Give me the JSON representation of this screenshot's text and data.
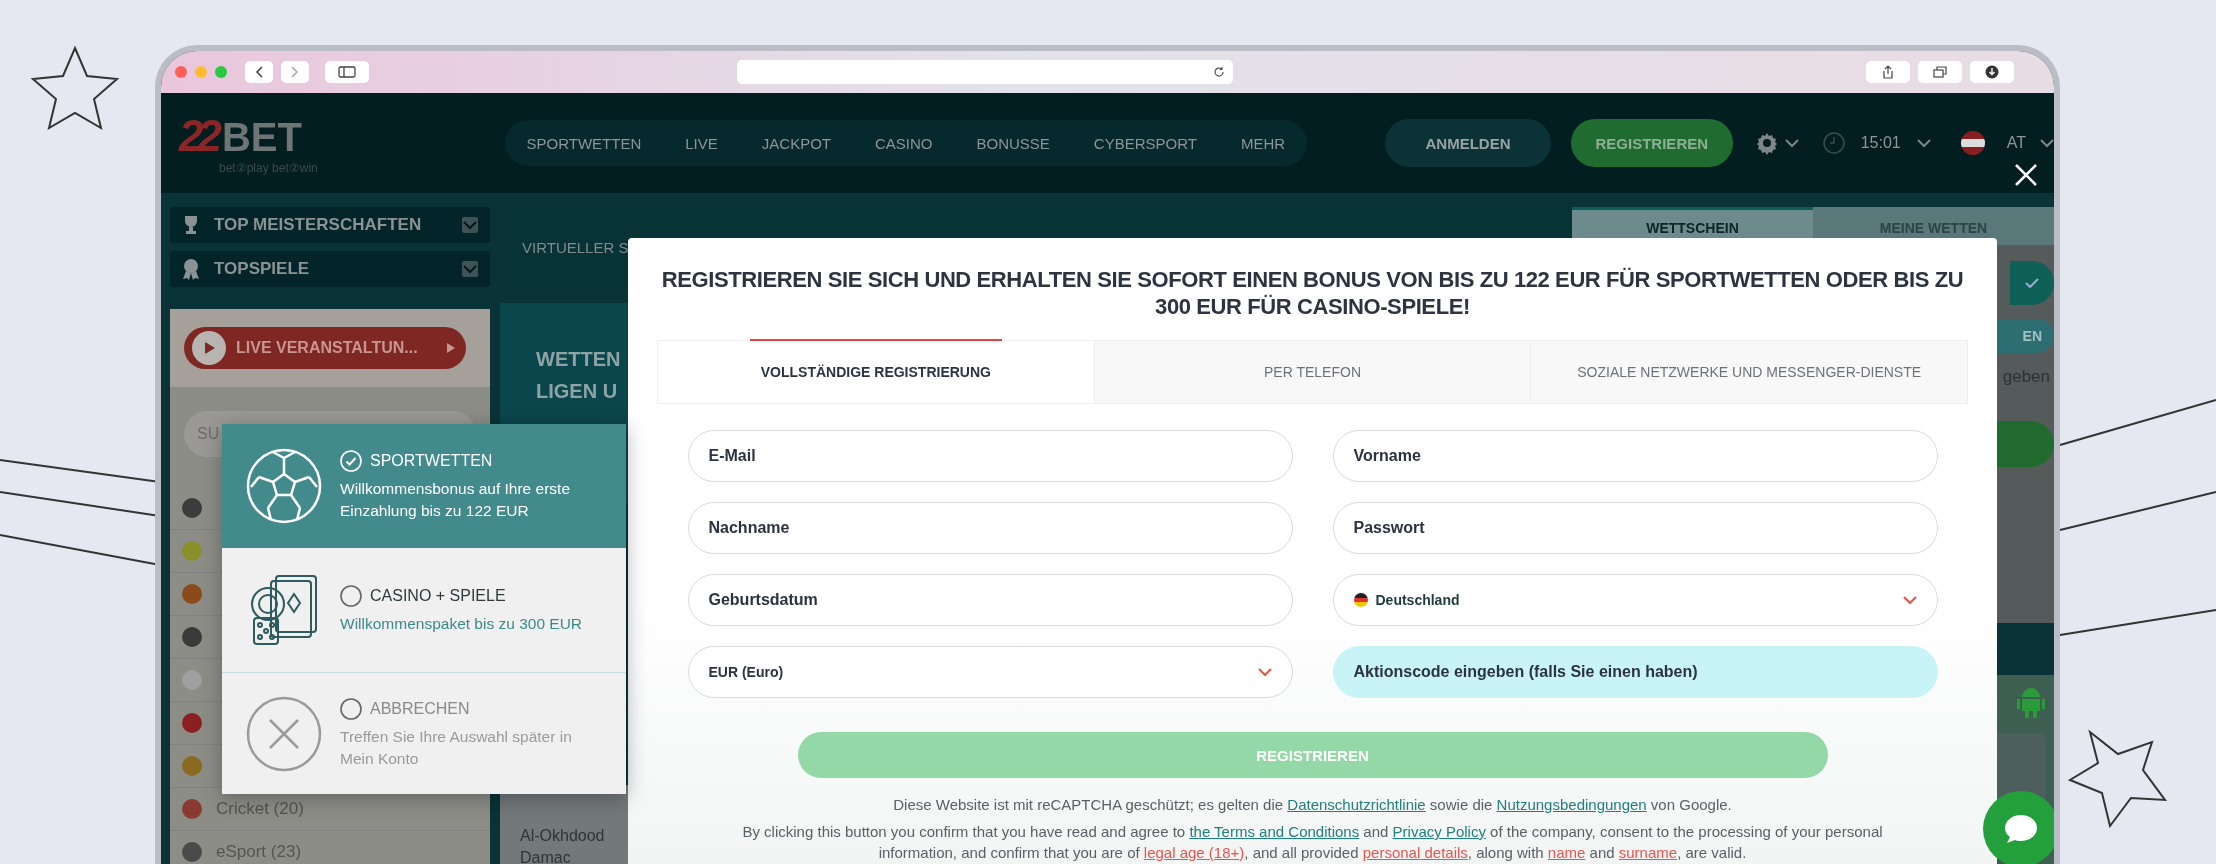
{
  "header": {
    "logo": {
      "brand": "BET",
      "digits": "22",
      "slogan": "bet②play bet②win"
    },
    "nav": [
      "SPORTWETTEN",
      "LIVE",
      "JACKPOT",
      "CASINO",
      "BONUSSE",
      "CYBERSPORT",
      "MEHR"
    ],
    "login_button": "ANMELDEN",
    "register_button": "REGISTRIEREN",
    "time": "15:01",
    "region": "AT"
  },
  "sidebar": {
    "menu": [
      {
        "label": "TOP MEISTERSCHAFTEN",
        "kind": "trophy"
      },
      {
        "label": "TOPSPIELE",
        "kind": "medal"
      }
    ],
    "live_button": "LIVE VERANSTALTUN...",
    "search": {
      "placeholder": "SU"
    },
    "sports": [
      {
        "label": "Cricket (20)"
      },
      {
        "label": "eSport (23)"
      }
    ]
  },
  "main": {
    "virtual_label": "VIRTUELLER S",
    "banner_lines": [
      "WETTEN",
      "LIGEN U"
    ],
    "teams": [
      "Al-Okhdood",
      "Damac"
    ]
  },
  "betslip": {
    "tabs": [
      {
        "label": "WETTSCHEIN",
        "selected": true
      },
      {
        "label": "MEINE WETTEN",
        "selected": false
      }
    ],
    "button": "EN",
    "note": "geben"
  },
  "bonus_popup": {
    "options": [
      {
        "kind": "sport",
        "title": "SPORTWETTEN",
        "description": "Willkommensbonus auf Ihre erste Einzahlung bis zu 122 EUR",
        "selected": true
      },
      {
        "kind": "casino",
        "title": "CASINO + SPIELE",
        "description": "Willkommenspaket bis zu 300 EUR",
        "selected": false
      },
      {
        "kind": "cancel",
        "title": "ABBRECHEN",
        "description": "Treffen Sie Ihre Auswahl später in Mein Konto",
        "selected": false
      }
    ]
  },
  "modal": {
    "title": "REGISTRIEREN SIE SICH UND ERHALTEN SIE SOFORT EINEN BONUS VON BIS ZU 122 EUR FÜR SPORTWETTEN ODER BIS ZU 300 EUR FÜR CASINO-SPIELE!",
    "tabs": [
      {
        "label": "VOLLSTÄNDIGE REGISTRIERUNG",
        "selected": true
      },
      {
        "label": "PER TELEFON",
        "selected": false
      },
      {
        "label": "SOZIALE NETZWERKE UND MESSENGER-DIENSTE",
        "selected": false
      }
    ],
    "fields": [
      {
        "kind": "text",
        "placeholder": "E-Mail"
      },
      {
        "kind": "text",
        "placeholder": "Vorname"
      },
      {
        "kind": "text",
        "placeholder": "Nachname"
      },
      {
        "kind": "text",
        "placeholder": "Passwort"
      },
      {
        "kind": "text",
        "placeholder": "Geburtsdatum"
      },
      {
        "kind": "country",
        "value": "Deutschland"
      },
      {
        "kind": "select",
        "value": "EUR (Euro)"
      },
      {
        "kind": "promo",
        "label": "Aktionscode eingeben (falls Sie einen haben)"
      }
    ],
    "submit": "REGISTRIEREN",
    "recaptcha": [
      {
        "kind": "plain",
        "text": "Diese Website ist mit reCAPTCHA geschützt; es gelten die "
      },
      {
        "kind": "link",
        "text": "Datenschutzrichtlinie"
      },
      {
        "kind": "plain",
        "text": " sowie die "
      },
      {
        "kind": "link",
        "text": "Nutzungsbedingungen"
      },
      {
        "kind": "plain",
        "text": " von Google."
      }
    ],
    "consent": [
      {
        "kind": "plain",
        "text": "By clicking this button you confirm that you have read and agree to "
      },
      {
        "kind": "link",
        "text": "the Terms and Conditions"
      },
      {
        "kind": "plain",
        "text": " and "
      },
      {
        "kind": "link",
        "text": "Privacy Policy"
      },
      {
        "kind": "plain",
        "text": " of the company, consent to the processing of your personal information, and confirm that you are of "
      },
      {
        "kind": "highlight",
        "text": "legal age (18+)"
      },
      {
        "kind": "plain",
        "text": ", and all provided "
      },
      {
        "kind": "highlight",
        "text": "personal details"
      },
      {
        "kind": "plain",
        "text": ", along with "
      },
      {
        "kind": "highlight",
        "text": "name"
      },
      {
        "kind": "plain",
        "text": " and "
      },
      {
        "kind": "highlight",
        "text": "surname"
      },
      {
        "kind": "plain",
        "text": ", are valid."
      }
    ]
  }
}
